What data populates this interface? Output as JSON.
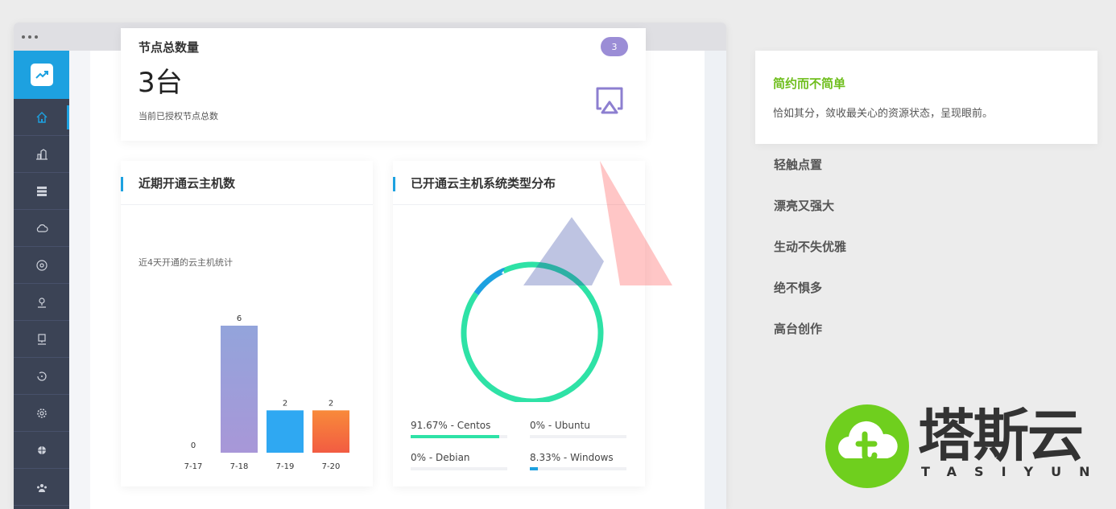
{
  "node_card": {
    "title": "节点总数量",
    "value": "3台",
    "subtitle": "当前已授权节点总数",
    "badge": "3"
  },
  "bar_card": {
    "title": "近期开通云主机数",
    "subtitle": "近4天开通的云主机统计"
  },
  "pie_card": {
    "title": "已开通云主机系统类型分布",
    "legend": [
      {
        "label": "91.67% - Centos",
        "percent": 91.67,
        "color": "#2ee2a6"
      },
      {
        "label": "0% - Ubuntu",
        "percent": 0,
        "color": "#1da1e0"
      },
      {
        "label": "0% - Debian",
        "percent": 0,
        "color": "#1da1e0"
      },
      {
        "label": "8.33% - Windows",
        "percent": 8.33,
        "color": "#1da1e0"
      }
    ]
  },
  "chart_data": [
    {
      "type": "bar",
      "categories": [
        "7-17",
        "7-18",
        "7-19",
        "7-20"
      ],
      "values": [
        0,
        6,
        2,
        2
      ],
      "title": "",
      "xlabel": "",
      "ylabel": "",
      "ylim": [
        0,
        6
      ],
      "grid": false,
      "colors": [
        "#9aa7da",
        "#9f92d6",
        "#2fa8f2",
        "#f66c3a"
      ]
    },
    {
      "type": "pie",
      "categories": [
        "Centos",
        "Ubuntu",
        "Debian",
        "Windows"
      ],
      "values": [
        91.67,
        0,
        0,
        8.33
      ],
      "colors": [
        "#2ee2a6",
        "#1da1e0",
        "#1da1e0",
        "#1da1e0"
      ]
    }
  ],
  "features": {
    "active": {
      "title": "简约而不简单",
      "desc": "恰如其分，敛收最关心的资源状态，呈现眼前。"
    },
    "items": [
      "轻触点置",
      "漂亮又强大",
      "生动不失优雅",
      "绝不惧多",
      "高台创作"
    ]
  },
  "brand": {
    "name": "塔斯云",
    "sub": "TASIYUN",
    "color": "#6fcf1e"
  },
  "sidebar": {
    "icons": [
      "home-icon",
      "building-icon",
      "server-icon",
      "cloud-icon",
      "disk-icon",
      "location-icon",
      "monitor-icon",
      "backup-icon",
      "settings-icon",
      "globe-icon",
      "group-icon"
    ]
  }
}
